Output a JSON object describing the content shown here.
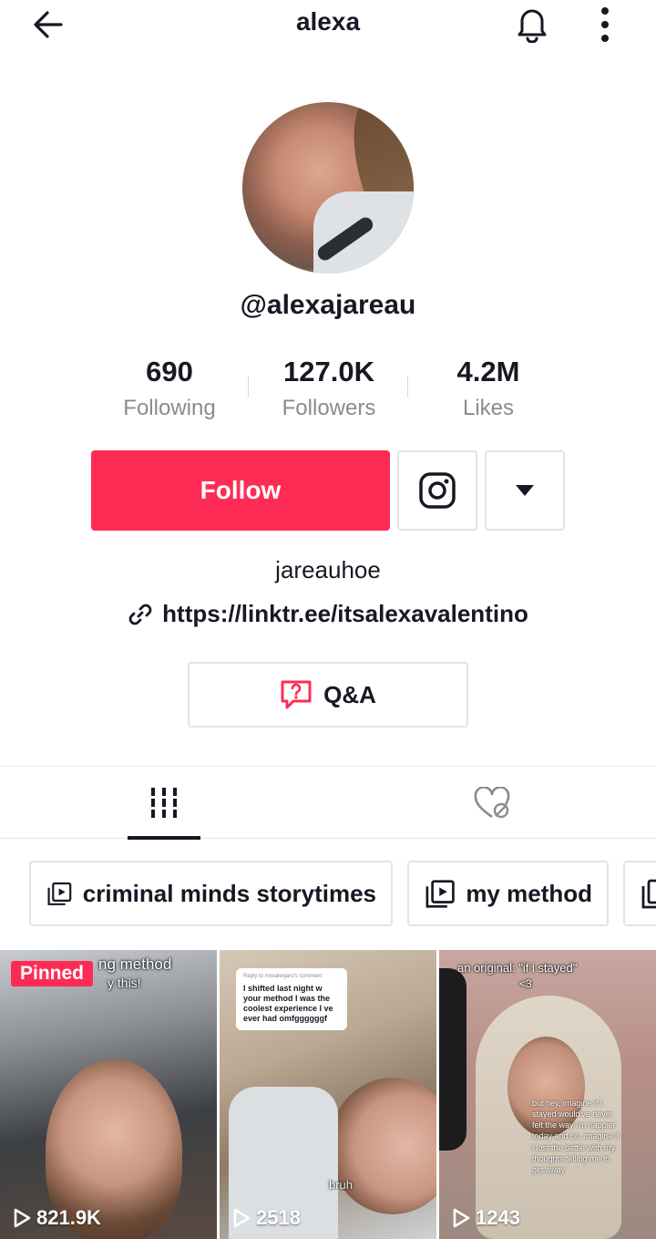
{
  "header": {
    "title": "alexa"
  },
  "profile": {
    "handle": "@alexajareau",
    "bio": "jareauhoe",
    "link": "https://linktr.ee/itsalexavalentino"
  },
  "stats": [
    {
      "value": "690",
      "label": "Following"
    },
    {
      "value": "127.0K",
      "label": "Followers"
    },
    {
      "value": "4.2M",
      "label": "Likes"
    }
  ],
  "actions": {
    "follow_label": "Follow",
    "qa_label": "Q&A"
  },
  "icons": {
    "back": "arrow-left-icon",
    "bell": "bell-icon",
    "more": "more-vertical-icon",
    "instagram": "instagram-icon",
    "dropdown": "caret-down-icon",
    "link": "link-icon",
    "qa": "question-bubble-icon",
    "videos_tab": "grid-icon",
    "liked_tab": "hidden-heart-icon",
    "playlist": "playlist-icon",
    "play": "play-icon"
  },
  "colors": {
    "accent": "#fe2c55",
    "text": "#161823",
    "muted": "#8a8b91"
  },
  "playlists": [
    {
      "label": "criminal minds storytimes"
    },
    {
      "label": "my method"
    }
  ],
  "videos": [
    {
      "views": "821.9K",
      "pinned_label": "Pinned",
      "caption_line1": "ng method",
      "caption_line2": "y this!"
    },
    {
      "views": "2518",
      "comment_header": "Reply to mxxalexjaro's comment",
      "comment_text": "I shifted last night w your method I was the coolest experience I ve ever had omfggggggf",
      "watermark": "bruh"
    },
    {
      "views": "1243",
      "caption_line1": "an original: \"if i stayed\"",
      "caption_line2": "<3",
      "lyrics": "but hey, imagine if i stayed would've never felt the way i'm happier today and oh, imagine if i lost the battle with my thoughts telling me to get away"
    }
  ]
}
